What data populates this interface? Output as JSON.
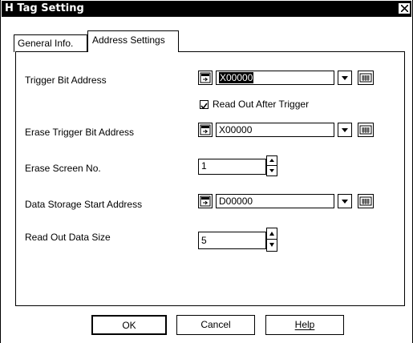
{
  "window": {
    "title": "H Tag Setting"
  },
  "tabs": [
    {
      "label": "General Info."
    },
    {
      "label": "Address Settings"
    }
  ],
  "fields": {
    "trigger_bit": {
      "label": "Trigger Bit Address",
      "value": "X00000"
    },
    "read_out_after_trigger": {
      "label": "Read Out After Trigger",
      "checked": true
    },
    "erase_trigger_bit": {
      "label": "Erase Trigger Bit Address",
      "value": "X00000"
    },
    "erase_screen_no": {
      "label": "Erase Screen No.",
      "value": "1"
    },
    "data_storage_start": {
      "label": "Data Storage Start Address",
      "value": "D00000"
    },
    "read_out_data_size": {
      "label": "Read Out Data Size",
      "value": "5"
    }
  },
  "buttons": {
    "ok": "OK",
    "cancel": "Cancel",
    "help": "Help"
  },
  "icons": [
    "close-icon",
    "address-picker-icon",
    "dropdown-arrow-icon",
    "keypad-icon",
    "spin-up-icon",
    "spin-down-icon",
    "checkmark-icon"
  ]
}
